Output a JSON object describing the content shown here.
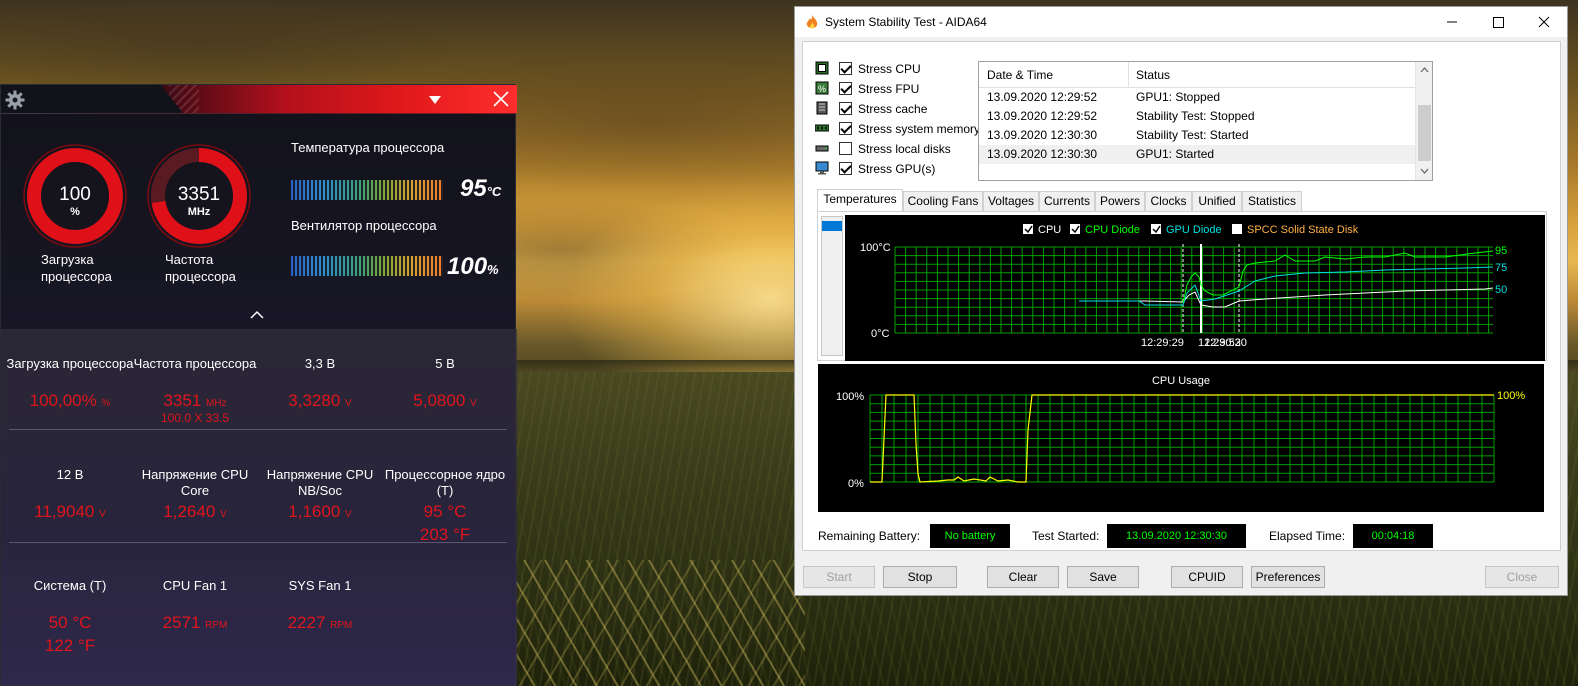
{
  "armory": {
    "cpu_load_value": "100",
    "cpu_load_unit": "%",
    "cpu_load_label_1": "Загрузка",
    "cpu_load_label_2": "процессора",
    "cpu_freq_value": "3351",
    "cpu_freq_unit": "MHz",
    "cpu_freq_label_1": "Частота",
    "cpu_freq_label_2": "процессора",
    "temp_title": "Температура процессора",
    "temp_value": "95",
    "temp_unit": "°C",
    "fan_title": "Вентилятор процессора",
    "fan_value": "100",
    "fan_unit": "%",
    "cells": [
      {
        "title": "Загрузка процессора",
        "value": "100,00%",
        "unit": "%",
        "sub": ""
      },
      {
        "title": "Частота процессора",
        "value": "3351",
        "unit": "MHz",
        "sub": "100.0 X 33.5"
      },
      {
        "title": "3,3 B",
        "value": "3,3280",
        "unit": "V",
        "sub": ""
      },
      {
        "title": "5 B",
        "value": "5,0800",
        "unit": "V",
        "sub": ""
      },
      {
        "title": "12 B",
        "value": "11,9040",
        "unit": "V",
        "sub": ""
      },
      {
        "title": "Напряжение CPU Core",
        "value": "1,2640",
        "unit": "V",
        "sub": ""
      },
      {
        "title": "Напряжение CPU NB/Soc",
        "value": "1,1600",
        "unit": "V",
        "sub": ""
      },
      {
        "title": "Процессорное ядро (T)",
        "value": "95 °C",
        "unit": "",
        "sub": "203 °F"
      },
      {
        "title": "Система (T)",
        "value": "50 °C",
        "unit": "",
        "sub": "122 °F"
      },
      {
        "title": "CPU Fan 1",
        "value": "2571",
        "unit": "RPM",
        "sub": ""
      },
      {
        "title": "SYS Fan 1",
        "value": "2227",
        "unit": "RPM",
        "sub": ""
      }
    ],
    "icons": [
      "gear-icon",
      "dropdown-arrow-icon",
      "close-icon",
      "chevron-up-icon"
    ]
  },
  "aida": {
    "title": "System Stability Test - AIDA64",
    "stress": [
      {
        "label": "Stress CPU",
        "checked": true
      },
      {
        "label": "Stress FPU",
        "checked": true
      },
      {
        "label": "Stress cache",
        "checked": true
      },
      {
        "label": "Stress system memory",
        "checked": true
      },
      {
        "label": "Stress local disks",
        "checked": false
      },
      {
        "label": "Stress GPU(s)",
        "checked": true
      }
    ],
    "log_headers": [
      "Date & Time",
      "Status"
    ],
    "log_rows": [
      {
        "time": "13.09.2020 12:29:52",
        "status": "GPU1: Stopped"
      },
      {
        "time": "13.09.2020 12:29:52",
        "status": "Stability Test: Stopped"
      },
      {
        "time": "13.09.2020 12:30:30",
        "status": "Stability Test: Started"
      },
      {
        "time": "13.09.2020 12:30:30",
        "status": "GPU1: Started"
      }
    ],
    "tabs": [
      "Temperatures",
      "Cooling Fans",
      "Voltages",
      "Currents",
      "Powers",
      "Clocks",
      "Unified",
      "Statistics"
    ],
    "temp_graph": {
      "legend": [
        {
          "label": "CPU",
          "checked": true,
          "color": "#ffffff"
        },
        {
          "label": "CPU Diode",
          "checked": true,
          "color": "#00ff00"
        },
        {
          "label": "GPU Diode",
          "checked": true,
          "color": "#00e0e0"
        },
        {
          "label": "SPCC Solid State Disk",
          "checked": false,
          "color": "#ffb040"
        }
      ],
      "y_top": "100°C",
      "y_bottom": "0°C",
      "time_label_1": "12:29:29",
      "time_label_2": "12:29:52",
      "time_label_3": "12:30:30",
      "right_labels": [
        "95",
        "75",
        "50"
      ]
    },
    "cpu_graph": {
      "title": "CPU Usage",
      "y_top": "100%",
      "y_bottom": "0%",
      "right_label": "100%"
    },
    "status": {
      "battery_label": "Remaining Battery:",
      "battery_value": "No battery",
      "started_label": "Test Started:",
      "started_value": "13.09.2020 12:30:30",
      "elapsed_label": "Elapsed Time:",
      "elapsed_value": "00:04:18"
    },
    "buttons": {
      "start": "Start",
      "stop": "Stop",
      "clear": "Clear",
      "save": "Save",
      "cpuid": "CPUID",
      "preferences": "Preferences",
      "close": "Close"
    }
  }
}
